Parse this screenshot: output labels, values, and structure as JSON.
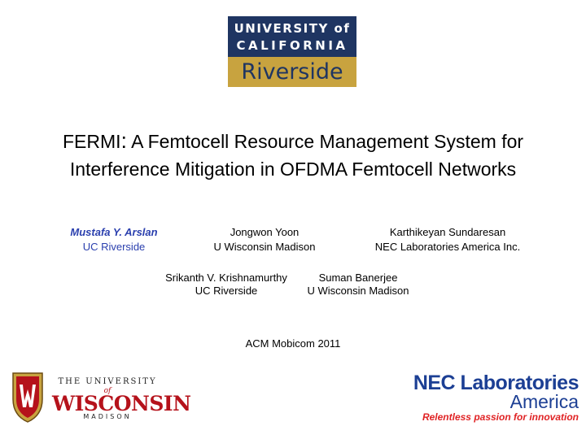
{
  "logos": {
    "ucr": {
      "line1": "UNIVERSITY of",
      "line2": "CALIFORNIA",
      "line3": "Riverside",
      "colors": {
        "navy": "#1f3562",
        "gold": "#c8a33f"
      }
    },
    "wisconsin": {
      "line1": "THE UNIVERSITY",
      "line2": "of",
      "line3": "WISCONSIN",
      "line4": "MADISON",
      "colors": {
        "red": "#b5121b"
      }
    },
    "nec": {
      "line1": "NEC Laboratories",
      "line2": "America",
      "line3": "Relentless passion for innovation",
      "colors": {
        "blue": "#1c3f94",
        "red": "#e02224"
      }
    }
  },
  "title": {
    "acronym": "FERMI",
    "colon": ":",
    "rest_line1": " A Femtocell Resource Management System for",
    "line2": "Interference Mitigation in OFDMA Femtocell Networks"
  },
  "authors": [
    {
      "name": "Mustafa Y. Arslan",
      "affiliation": "UC Riverside"
    },
    {
      "name": "Jongwon Yoon",
      "affiliation": "U Wisconsin Madison"
    },
    {
      "name": "Karthikeyan Sundaresan",
      "affiliation": "NEC Laboratories America Inc."
    },
    {
      "name": "Srikanth V. Krishnamurthy",
      "affiliation": "UC Riverside"
    },
    {
      "name": "Suman Banerjee",
      "affiliation": "U Wisconsin Madison"
    }
  ],
  "highlight_color": "#2a3fae",
  "venue": "ACM Mobicom 2011"
}
